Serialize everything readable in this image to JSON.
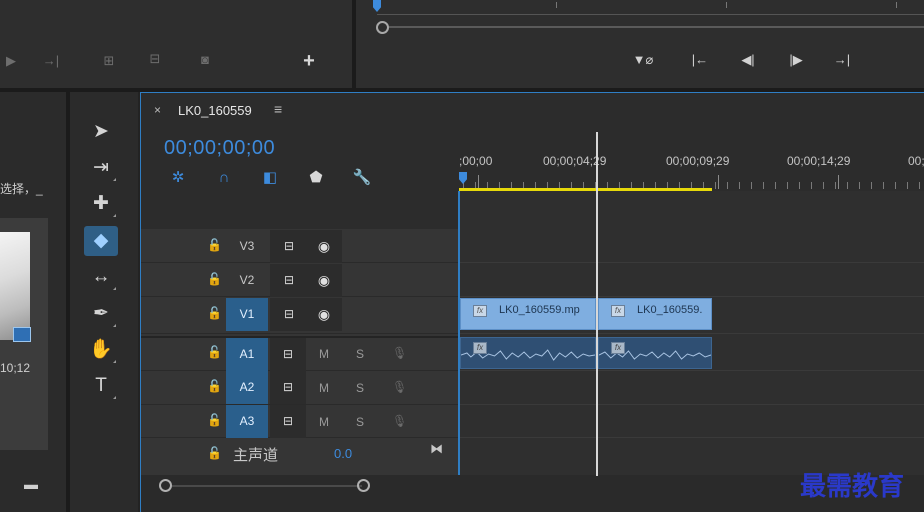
{
  "source_toolbar": {
    "icons": [
      "step-forward-icon",
      "go-to-out-icon",
      "insert-icon",
      "overwrite-icon",
      "export-frame-icon"
    ],
    "add_button": "+"
  },
  "program_monitor": {
    "icons": [
      "lift-extract-icon",
      "go-to-in-icon",
      "step-back-icon",
      "step-forward-icon",
      "go-to-out-icon"
    ]
  },
  "project_panel": {
    "text_fragment": "选择，_",
    "clip_duration": "10;12"
  },
  "tools": [
    {
      "name": "selection-tool",
      "icon": "arrow-icon",
      "glyph": "➤"
    },
    {
      "name": "track-select-tool",
      "icon": "track-select-icon",
      "glyph": "⇥"
    },
    {
      "name": "ripple-edit-tool",
      "icon": "ripple-edit-icon",
      "glyph": "✚"
    },
    {
      "name": "razor-tool",
      "icon": "razor-icon",
      "glyph": "◆"
    },
    {
      "name": "slip-tool",
      "icon": "slip-icon",
      "glyph": "↔"
    },
    {
      "name": "pen-tool",
      "icon": "pen-icon",
      "glyph": "✒"
    },
    {
      "name": "hand-tool",
      "icon": "hand-icon",
      "glyph": "✋"
    },
    {
      "name": "type-tool",
      "icon": "type-icon",
      "glyph": "T"
    }
  ],
  "sequence": {
    "close": "×",
    "title": "LK0_160559",
    "menu": "≡",
    "timecode": "00;00;00;00",
    "ruler_labels": [
      ";00;00",
      "00;00;04;29",
      "00;00;09;29",
      "00;00;14;29",
      "00;"
    ],
    "accent_color": "#3d8bdd",
    "work_area_color": "#e6d90a"
  },
  "tracks": {
    "video": [
      {
        "name": "V3",
        "target": false
      },
      {
        "name": "V2",
        "target": false
      },
      {
        "name": "V1",
        "target": true
      }
    ],
    "audio": [
      {
        "name": "A1",
        "mute": "M",
        "solo": "S"
      },
      {
        "name": "A2",
        "mute": "M",
        "solo": "S"
      },
      {
        "name": "A3",
        "mute": "M",
        "solo": "S"
      }
    ],
    "master": {
      "label": "主声道",
      "value": "0.0"
    }
  },
  "clips": {
    "video": [
      {
        "label": "LK0_160559.mp"
      },
      {
        "label": "LK0_160559."
      }
    ]
  },
  "watermark": "最需教育"
}
